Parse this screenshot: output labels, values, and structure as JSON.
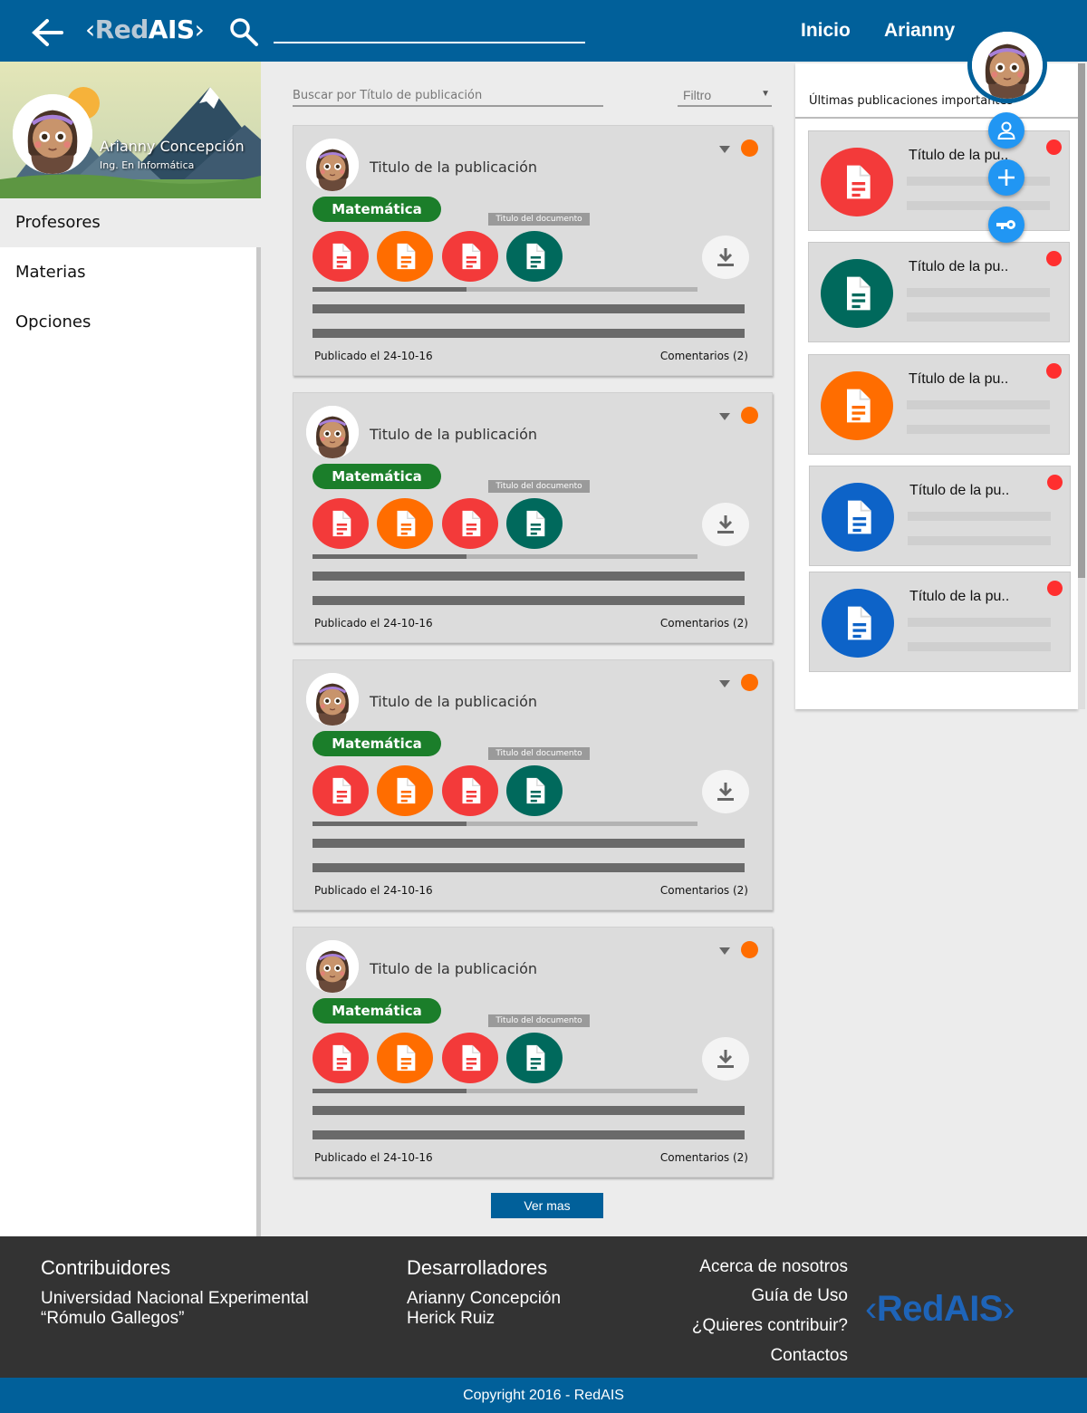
{
  "header": {
    "logo_left": "‹",
    "logo_red": "Red",
    "logo_ais": "AIS",
    "logo_right": "›",
    "search_value": "",
    "nav_home": "Inicio",
    "nav_user": "Arianny"
  },
  "profile": {
    "name": "Arianny Concepción",
    "role": "Ing. En Informática"
  },
  "sidebar": {
    "items": [
      {
        "label": "Profesores",
        "active": true
      },
      {
        "label": "Materias",
        "active": false
      },
      {
        "label": "Opciones",
        "active": false
      }
    ]
  },
  "feed": {
    "search_placeholder": "Buscar por Título de publicación",
    "filter_label": "Filtro",
    "cards": [
      {
        "title": "Titulo de la publicación",
        "subject": "Matemática",
        "doc_label": "Titulo del documento",
        "progress": 0.4,
        "date": "Publicado el 24-10-16",
        "comments": "Comentarios  (2)"
      },
      {
        "title": "Titulo de la publicación",
        "subject": "Matemática",
        "doc_label": "Titulo del documento",
        "progress": 0.4,
        "date": "Publicado el 24-10-16",
        "comments": "Comentarios  (2)"
      },
      {
        "title": "Titulo de la publicación",
        "subject": "Matemática",
        "doc_label": "Titulo del documento",
        "progress": 0.4,
        "date": "Publicado el 24-10-16",
        "comments": "Comentarios  (2)"
      },
      {
        "title": "Titulo de la publicación",
        "subject": "Matemática",
        "doc_label": "Titulo del documento",
        "progress": 0.4,
        "date": "Publicado el 24-10-16",
        "comments": "Comentarios  (2)"
      }
    ],
    "file_colors": [
      "#f33a3a",
      "#ff6d00",
      "#f33a3a",
      "#00695c"
    ],
    "more_button": "Ver mas"
  },
  "right_panel": {
    "title": "Últimas publicaciones importantes",
    "items": [
      {
        "title": "Título de la pu..",
        "color": "#f33a3a"
      },
      {
        "title": "Título de la pu..",
        "color": "#00695c"
      },
      {
        "title": "Título de la pu..",
        "color": "#ff6d00"
      },
      {
        "title": "Título de la pu..",
        "color": "#0d63c8"
      },
      {
        "title": "Título de la pu..",
        "color": "#0d63c8"
      }
    ],
    "fab_icons": [
      "person-icon",
      "plus-icon",
      "key-icon"
    ]
  },
  "footer": {
    "contributors_heading": "Contribuidores",
    "contributors_line1": "Universidad Nacional Experimental",
    "contributors_line2": "“Rómulo Gallegos”",
    "developers_heading": "Desarrolladores",
    "developers": [
      "Arianny Concepción",
      "Herick Ruiz"
    ],
    "links": [
      "Acerca de nosotros",
      "Guía de Uso",
      "¿Quieres contribuir?",
      "Contactos"
    ],
    "logo_left": "‹",
    "logo_text": "RedAIS",
    "logo_right": "›",
    "copyright": "Copyright 2016 - RedAIS"
  },
  "colors": {
    "primary": "#01609a",
    "accent_green": "#1b7e2a",
    "status_orange": "#ff6d00",
    "alert_red": "#ff2f2f",
    "fab_blue": "#2196f3"
  }
}
